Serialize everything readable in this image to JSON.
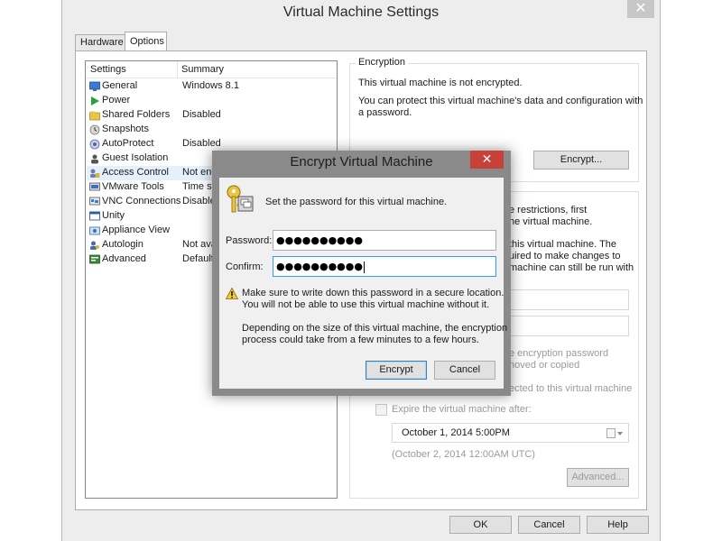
{
  "window": {
    "title": "Virtual Machine Settings",
    "close_glyph": "✕"
  },
  "tabs": [
    {
      "label": "Hardware"
    },
    {
      "label": "Options"
    }
  ],
  "list": {
    "col_settings": "Settings",
    "col_summary": "Summary",
    "rows": [
      {
        "name": "General",
        "summary": "Windows 8.1",
        "icon": "monitor-icon"
      },
      {
        "name": "Power",
        "summary": "",
        "icon": "power-play-icon"
      },
      {
        "name": "Shared Folders",
        "summary": "Disabled",
        "icon": "folder-icon"
      },
      {
        "name": "Snapshots",
        "summary": "",
        "icon": "snapshot-icon"
      },
      {
        "name": "AutoProtect",
        "summary": "Disabled",
        "icon": "autoprotect-icon"
      },
      {
        "name": "Guest Isolation",
        "summary": "",
        "icon": "guest-isolation-icon"
      },
      {
        "name": "Access Control",
        "summary": "Not enc",
        "icon": "access-control-icon"
      },
      {
        "name": "VMware Tools",
        "summary": "Time sy",
        "icon": "vmware-tools-icon"
      },
      {
        "name": "VNC Connections",
        "summary": "Disabled",
        "icon": "vnc-icon"
      },
      {
        "name": "Unity",
        "summary": "",
        "icon": "unity-icon"
      },
      {
        "name": "Appliance View",
        "summary": "",
        "icon": "appliance-view-icon"
      },
      {
        "name": "Autologin",
        "summary": "Not ava",
        "icon": "autologin-icon"
      },
      {
        "name": "Advanced",
        "summary": "Default/",
        "icon": "advanced-icon"
      }
    ]
  },
  "encryption": {
    "group_title": "Encryption",
    "status": "This virtual machine is not encrypted.",
    "desc_line1": "You can protect this virtual machine's data and configuration with",
    "desc_line2": "a password.",
    "encrypt_button": "Encrypt..."
  },
  "restrictions": {
    "frag1": "e restrictions, first",
    "frag2": "he virtual machine.",
    "frag3": "this virtual machine. The",
    "frag4": "uired to make changes to",
    "frag5": "machine can still be run with",
    "frag6": "e encryption password",
    "frag7": "noved or copied",
    "frag8": "ected to this virtual machine",
    "expire_label": "Expire the virtual machine after:",
    "expire_date": "October   1, 2014   5:00PM",
    "expire_utc": "(October 2, 2014 12:00AM UTC)",
    "advanced_button": "Advanced..."
  },
  "footer": {
    "ok": "OK",
    "cancel": "Cancel",
    "help": "Help"
  },
  "dialog": {
    "title": "Encrypt Virtual Machine",
    "close_glyph": "✕",
    "prompt": "Set the password for this virtual machine.",
    "password_label": "Password:",
    "password_value": "●●●●●●●●●●",
    "confirm_label": "Confirm:",
    "confirm_value": "●●●●●●●●●●",
    "warn_line1": "Make sure to write down this password in a secure location.",
    "warn_line2": "You will not be able to use this virtual machine without it.",
    "info_line1": "Depending on the size of this virtual machine, the encryption",
    "info_line2": "process could take from a few minutes to a few hours.",
    "encrypt_button": "Encrypt",
    "cancel_button": "Cancel"
  },
  "colors": {
    "dialog_close": "#c7403a",
    "selection": "#e5f0fb",
    "focus_border": "#3399ff",
    "default_button_border": "#3c7fb1"
  }
}
